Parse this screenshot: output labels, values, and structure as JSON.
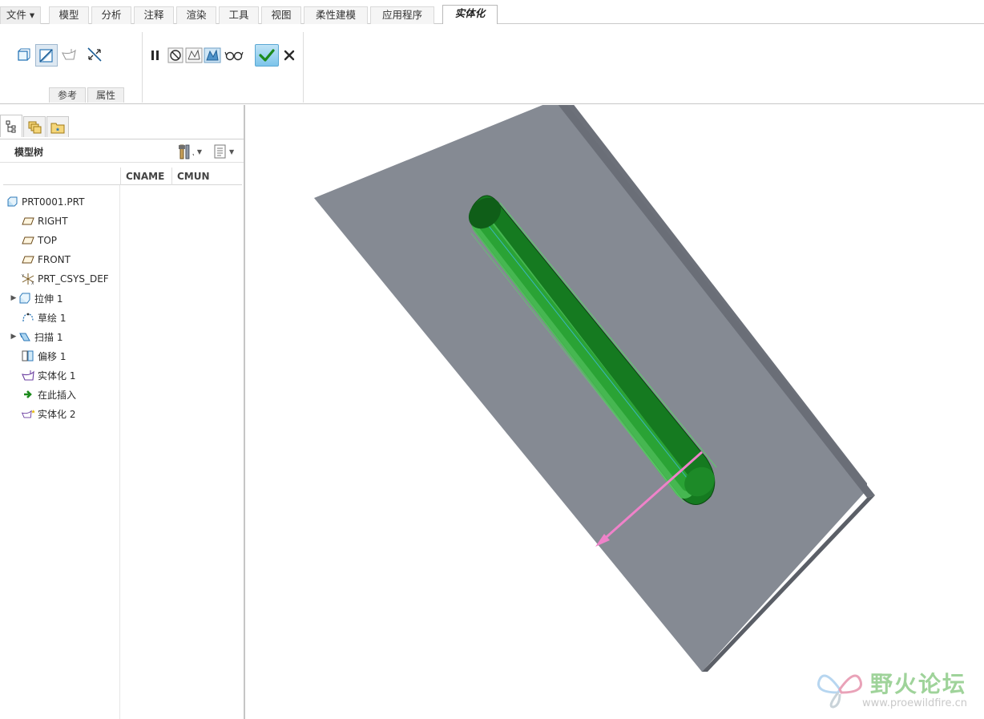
{
  "ribbon": {
    "tabs": [
      {
        "label": "文件 ▾"
      },
      {
        "label": "模型"
      },
      {
        "label": "分析"
      },
      {
        "label": "注释"
      },
      {
        "label": "渲染"
      },
      {
        "label": "工具"
      },
      {
        "label": "视图"
      },
      {
        "label": "柔性建模"
      },
      {
        "label": "应用程序"
      },
      {
        "label": "实体化"
      }
    ],
    "active_tab": "实体化",
    "sub_tabs": [
      "参考",
      "属性"
    ],
    "selected_icon": "solidify-remove-material-icon"
  },
  "panel": {
    "tree_title": "模型树",
    "columns": [
      "CNAME",
      "CMUN"
    ],
    "items": [
      {
        "label": "PRT0001.PRT",
        "icon": "part-icon",
        "expandable": false
      },
      {
        "label": "RIGHT",
        "icon": "datum-plane-icon",
        "expandable": false
      },
      {
        "label": "TOP",
        "icon": "datum-plane-icon",
        "expandable": false
      },
      {
        "label": "FRONT",
        "icon": "datum-plane-icon",
        "expandable": false
      },
      {
        "label": "PRT_CSYS_DEF",
        "icon": "csys-icon",
        "expandable": false
      },
      {
        "label": "拉伸 1",
        "icon": "extrude-icon",
        "expandable": true
      },
      {
        "label": "草绘 1",
        "icon": "sketch-icon",
        "expandable": false
      },
      {
        "label": "扫描 1",
        "icon": "sweep-icon",
        "expandable": true
      },
      {
        "label": "偏移 1",
        "icon": "offset-icon",
        "expandable": false
      },
      {
        "label": "实体化 1",
        "icon": "solidify-icon",
        "expandable": false
      },
      {
        "label": "在此插入",
        "icon": "insert-here-arrow-icon",
        "expandable": false
      },
      {
        "label": "实体化 2",
        "icon": "solidify-active-icon",
        "expandable": false
      }
    ]
  },
  "colors": {
    "plate_top": "#858a93",
    "plate_side": "#6a6e77",
    "slot_green": "#1f8a2a",
    "direction_arrow": "#ef82c9",
    "ok_button": "#7cc4ea"
  },
  "watermark": {
    "title": "野火论坛",
    "url": "www.proewildfire.cn"
  }
}
